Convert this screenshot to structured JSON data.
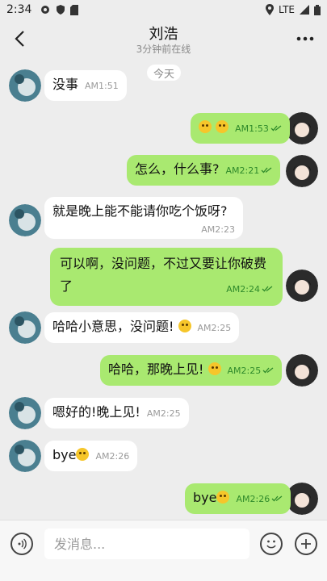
{
  "status_bar": {
    "time": "2:34",
    "network": "LTE"
  },
  "header": {
    "title": "刘浩",
    "subtitle": "3分钟前在线"
  },
  "day_separator": "今天",
  "messages": [
    {
      "side": "in",
      "text": "没事",
      "time": "AM1:51"
    },
    {
      "side": "out",
      "text": "",
      "emojis": [
        "grinning-squint-face-emoji",
        "grimacing-face-emoji"
      ],
      "time": "AM1:53"
    },
    {
      "side": "out",
      "text": "怎么，什么事?",
      "time": "AM2:21"
    },
    {
      "side": "in",
      "text": "就是晚上能不能请你吃个饭呀?",
      "time": "AM2:23"
    },
    {
      "side": "out",
      "text": "可以啊，没问题，不过又要让你破费了",
      "time": "AM2:24"
    },
    {
      "side": "in",
      "text": "哈哈小意思，没问题!",
      "emojis": [
        "grimacing-face-emoji"
      ],
      "time": "AM2:25"
    },
    {
      "side": "out",
      "text": "哈哈，那晚上见!",
      "emojis": [
        "grinning-sweat-face-emoji"
      ],
      "time": "AM2:25"
    },
    {
      "side": "in",
      "text": "嗯好的!晚上见!",
      "time": "AM2:25"
    },
    {
      "side": "in",
      "text": "bye",
      "emojis": [
        "winking-kiss-face-emoji"
      ],
      "time": "AM2:26"
    },
    {
      "side": "out",
      "text": "bye",
      "emojis": [
        "smiling-face-emoji"
      ],
      "time": "AM2:26"
    }
  ],
  "input": {
    "placeholder": "发消息..."
  },
  "colors": {
    "outgoing_bubble": "#a9e970",
    "incoming_bubble": "#ffffff",
    "background": "#ededed",
    "read_tick": "#2f8a2b"
  }
}
